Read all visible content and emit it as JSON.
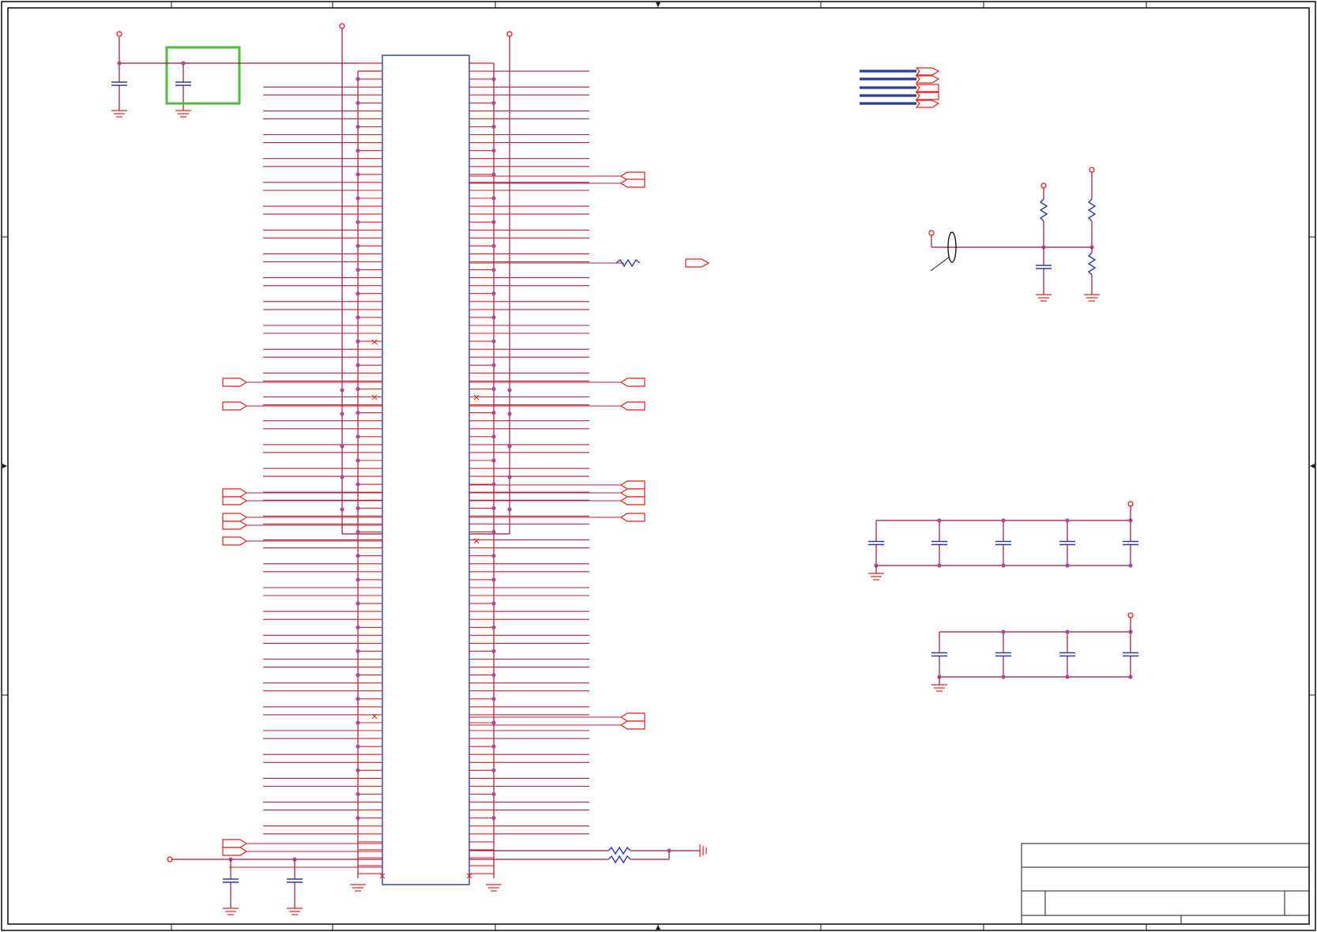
{
  "sheet": {
    "title": "",
    "colors": {
      "wire": "#a0143c",
      "pin": "#e0211c",
      "component": "#2b3f9a",
      "junction": "#b0479f",
      "highlight": "#4fbe3a",
      "frame": "#1a1a1a"
    }
  },
  "elements": {
    "connector_ic": "ic-connector",
    "decoupling_capacitor_highlighted": "capacitor",
    "signal_bus": "bus-lines",
    "reset_network": "rc-network",
    "capacitor_bank_upper": "capacitor-bank",
    "capacitor_bank_lower": "capacitor-bank",
    "title_block": "title-block"
  }
}
